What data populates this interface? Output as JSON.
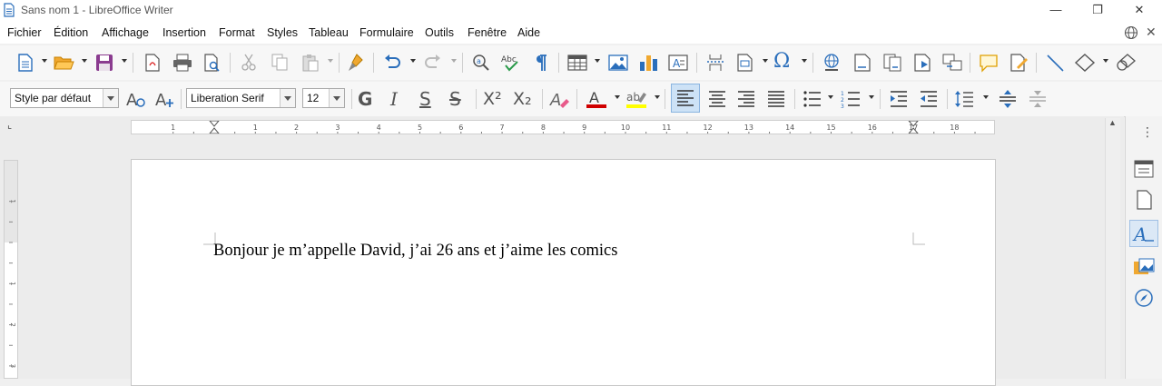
{
  "window": {
    "title": "Sans nom 1 - LibreOffice Writer",
    "controls": [
      "—",
      "❐",
      "✕"
    ]
  },
  "menubar": {
    "items": [
      {
        "label": "Fichier"
      },
      {
        "label": "Édition"
      },
      {
        "label": "Affichage"
      },
      {
        "label": "Insertion"
      },
      {
        "label": "Format"
      },
      {
        "label": "Styles"
      },
      {
        "label": "Tableau"
      },
      {
        "label": "Formulaire"
      },
      {
        "label": "Outils"
      },
      {
        "label": "Fenêtre"
      },
      {
        "label": "Aide"
      }
    ]
  },
  "formatting": {
    "paragraph_style": "Style par défaut",
    "font_name": "Liberation Serif",
    "font_size": "12",
    "bold_glyph": "G",
    "italic_glyph": "I",
    "underline_glyph": "S",
    "strike_glyph": "S",
    "superscript_glyph": "X²",
    "subscript_glyph": "X₂",
    "font_color": "#d00000",
    "highlight_color": "#ffff00",
    "active_alignment": "left"
  },
  "ruler": {
    "horizontal_labels": [
      "1",
      "1",
      "2",
      "3",
      "4",
      "5",
      "6",
      "7",
      "8",
      "9",
      "10",
      "11",
      "12",
      "13",
      "14",
      "15",
      "16",
      "17",
      "18"
    ],
    "vertical_labels": [
      "1",
      "1",
      "2",
      "3"
    ]
  },
  "document": {
    "text": "Bonjour je m’appelle David, j’ai 26 ans et j’aime les comics"
  },
  "colors": {
    "accent": "#2a6ebb",
    "toolbar_bg": "#f7f7f7",
    "page_bg": "#ffffff"
  }
}
